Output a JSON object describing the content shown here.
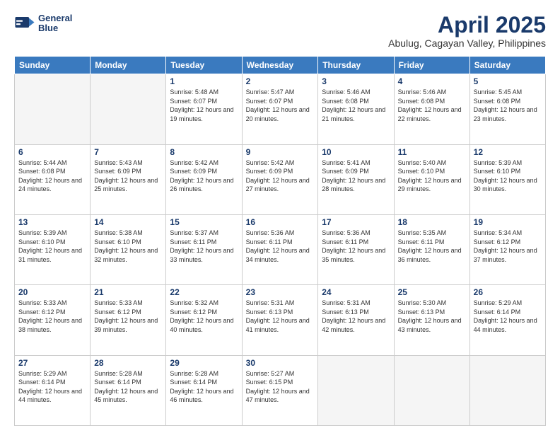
{
  "header": {
    "logo_line1": "General",
    "logo_line2": "Blue",
    "main_title": "April 2025",
    "subtitle": "Abulug, Cagayan Valley, Philippines"
  },
  "weekdays": [
    "Sunday",
    "Monday",
    "Tuesday",
    "Wednesday",
    "Thursday",
    "Friday",
    "Saturday"
  ],
  "weeks": [
    [
      {
        "day": "",
        "info": ""
      },
      {
        "day": "",
        "info": ""
      },
      {
        "day": "1",
        "info": "Sunrise: 5:48 AM\nSunset: 6:07 PM\nDaylight: 12 hours and 19 minutes."
      },
      {
        "day": "2",
        "info": "Sunrise: 5:47 AM\nSunset: 6:07 PM\nDaylight: 12 hours and 20 minutes."
      },
      {
        "day": "3",
        "info": "Sunrise: 5:46 AM\nSunset: 6:08 PM\nDaylight: 12 hours and 21 minutes."
      },
      {
        "day": "4",
        "info": "Sunrise: 5:46 AM\nSunset: 6:08 PM\nDaylight: 12 hours and 22 minutes."
      },
      {
        "day": "5",
        "info": "Sunrise: 5:45 AM\nSunset: 6:08 PM\nDaylight: 12 hours and 23 minutes."
      }
    ],
    [
      {
        "day": "6",
        "info": "Sunrise: 5:44 AM\nSunset: 6:08 PM\nDaylight: 12 hours and 24 minutes."
      },
      {
        "day": "7",
        "info": "Sunrise: 5:43 AM\nSunset: 6:09 PM\nDaylight: 12 hours and 25 minutes."
      },
      {
        "day": "8",
        "info": "Sunrise: 5:42 AM\nSunset: 6:09 PM\nDaylight: 12 hours and 26 minutes."
      },
      {
        "day": "9",
        "info": "Sunrise: 5:42 AM\nSunset: 6:09 PM\nDaylight: 12 hours and 27 minutes."
      },
      {
        "day": "10",
        "info": "Sunrise: 5:41 AM\nSunset: 6:09 PM\nDaylight: 12 hours and 28 minutes."
      },
      {
        "day": "11",
        "info": "Sunrise: 5:40 AM\nSunset: 6:10 PM\nDaylight: 12 hours and 29 minutes."
      },
      {
        "day": "12",
        "info": "Sunrise: 5:39 AM\nSunset: 6:10 PM\nDaylight: 12 hours and 30 minutes."
      }
    ],
    [
      {
        "day": "13",
        "info": "Sunrise: 5:39 AM\nSunset: 6:10 PM\nDaylight: 12 hours and 31 minutes."
      },
      {
        "day": "14",
        "info": "Sunrise: 5:38 AM\nSunset: 6:10 PM\nDaylight: 12 hours and 32 minutes."
      },
      {
        "day": "15",
        "info": "Sunrise: 5:37 AM\nSunset: 6:11 PM\nDaylight: 12 hours and 33 minutes."
      },
      {
        "day": "16",
        "info": "Sunrise: 5:36 AM\nSunset: 6:11 PM\nDaylight: 12 hours and 34 minutes."
      },
      {
        "day": "17",
        "info": "Sunrise: 5:36 AM\nSunset: 6:11 PM\nDaylight: 12 hours and 35 minutes."
      },
      {
        "day": "18",
        "info": "Sunrise: 5:35 AM\nSunset: 6:11 PM\nDaylight: 12 hours and 36 minutes."
      },
      {
        "day": "19",
        "info": "Sunrise: 5:34 AM\nSunset: 6:12 PM\nDaylight: 12 hours and 37 minutes."
      }
    ],
    [
      {
        "day": "20",
        "info": "Sunrise: 5:33 AM\nSunset: 6:12 PM\nDaylight: 12 hours and 38 minutes."
      },
      {
        "day": "21",
        "info": "Sunrise: 5:33 AM\nSunset: 6:12 PM\nDaylight: 12 hours and 39 minutes."
      },
      {
        "day": "22",
        "info": "Sunrise: 5:32 AM\nSunset: 6:12 PM\nDaylight: 12 hours and 40 minutes."
      },
      {
        "day": "23",
        "info": "Sunrise: 5:31 AM\nSunset: 6:13 PM\nDaylight: 12 hours and 41 minutes."
      },
      {
        "day": "24",
        "info": "Sunrise: 5:31 AM\nSunset: 6:13 PM\nDaylight: 12 hours and 42 minutes."
      },
      {
        "day": "25",
        "info": "Sunrise: 5:30 AM\nSunset: 6:13 PM\nDaylight: 12 hours and 43 minutes."
      },
      {
        "day": "26",
        "info": "Sunrise: 5:29 AM\nSunset: 6:14 PM\nDaylight: 12 hours and 44 minutes."
      }
    ],
    [
      {
        "day": "27",
        "info": "Sunrise: 5:29 AM\nSunset: 6:14 PM\nDaylight: 12 hours and 44 minutes."
      },
      {
        "day": "28",
        "info": "Sunrise: 5:28 AM\nSunset: 6:14 PM\nDaylight: 12 hours and 45 minutes."
      },
      {
        "day": "29",
        "info": "Sunrise: 5:28 AM\nSunset: 6:14 PM\nDaylight: 12 hours and 46 minutes."
      },
      {
        "day": "30",
        "info": "Sunrise: 5:27 AM\nSunset: 6:15 PM\nDaylight: 12 hours and 47 minutes."
      },
      {
        "day": "",
        "info": ""
      },
      {
        "day": "",
        "info": ""
      },
      {
        "day": "",
        "info": ""
      }
    ]
  ]
}
